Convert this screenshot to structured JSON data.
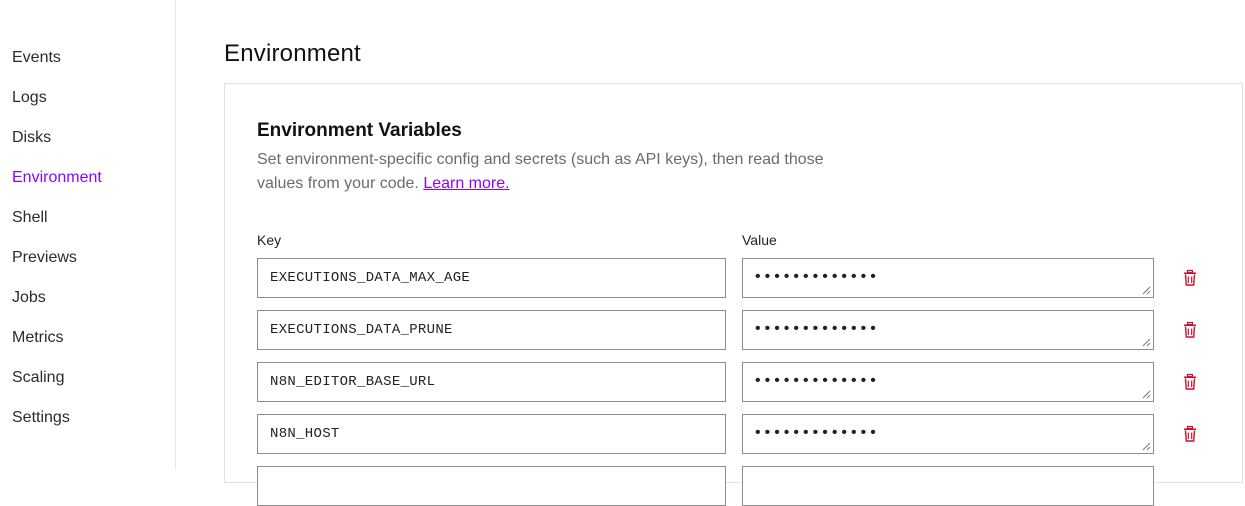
{
  "sidebar": {
    "items": [
      {
        "label": "Events"
      },
      {
        "label": "Logs"
      },
      {
        "label": "Disks"
      },
      {
        "label": "Environment",
        "active": true
      },
      {
        "label": "Shell"
      },
      {
        "label": "Previews"
      },
      {
        "label": "Jobs"
      },
      {
        "label": "Metrics"
      },
      {
        "label": "Scaling"
      },
      {
        "label": "Settings"
      }
    ]
  },
  "page": {
    "title": "Environment"
  },
  "env_section": {
    "title": "Environment Variables",
    "description": "Set environment-specific config and secrets (such as API keys), then read those values from your code.",
    "learn_more": "Learn more.",
    "key_label": "Key",
    "value_label": "Value",
    "rows": [
      {
        "key": "EXECUTIONS_DATA_MAX_AGE",
        "value": "•••••••••••••"
      },
      {
        "key": "EXECUTIONS_DATA_PRUNE",
        "value": "•••••••••••••"
      },
      {
        "key": "N8N_EDITOR_BASE_URL",
        "value": "•••••••••••••"
      },
      {
        "key": "N8N_HOST",
        "value": "•••••••••••••"
      }
    ]
  },
  "colors": {
    "accent": "#8a05ff",
    "delete": "#c8102e"
  },
  "icons": {
    "delete": "trash-icon",
    "resize": "resize-grip-icon"
  }
}
